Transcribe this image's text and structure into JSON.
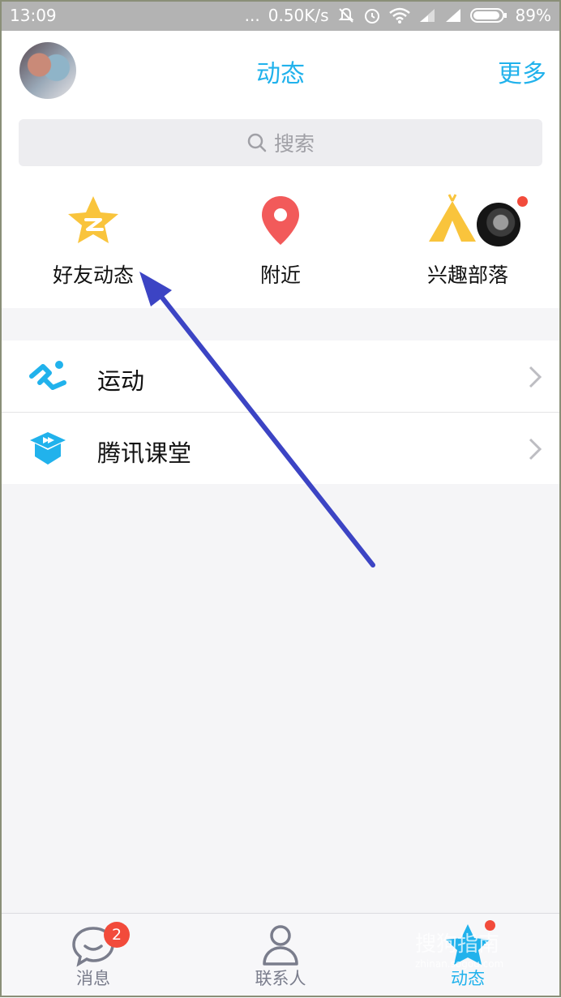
{
  "status_bar": {
    "time": "13:09",
    "dots": "...",
    "network_speed": "0.50K/s",
    "battery": "89%",
    "icons": [
      "mute-bell-icon",
      "alarm-icon",
      "wifi-icon",
      "signal-icon",
      "signal-icon",
      "battery-icon"
    ]
  },
  "header": {
    "title": "动态",
    "more": "更多",
    "avatar": "avatar"
  },
  "search": {
    "placeholder": "搜索",
    "icon": "search-icon"
  },
  "entries": [
    {
      "label": "好友动态",
      "icon": "star-z-icon",
      "color": "#f9c43c"
    },
    {
      "label": "附近",
      "icon": "location-pin-icon",
      "color": "#f25a5a"
    },
    {
      "label": "兴趣部落",
      "icon": "tent-icon",
      "color": "#f9c43c",
      "has_dot": true
    }
  ],
  "list": [
    {
      "label": "运动",
      "icon": "running-icon",
      "color": "#21b2ec"
    },
    {
      "label": "腾讯课堂",
      "icon": "classroom-icon",
      "color": "#21b2ec"
    }
  ],
  "tabs": [
    {
      "label": "消息",
      "icon": "chat-bubble-icon",
      "badge": "2",
      "active": false
    },
    {
      "label": "联系人",
      "icon": "person-icon",
      "active": false
    },
    {
      "label": "动态",
      "icon": "star-icon",
      "active": true,
      "has_dot": true
    }
  ],
  "watermark": {
    "text": "搜狗指南",
    "sub": "zhinan.sogou.com"
  },
  "colors": {
    "accent": "#21b2ec",
    "badge": "#f24b3b",
    "annotation_arrow": "#3c44c4"
  }
}
